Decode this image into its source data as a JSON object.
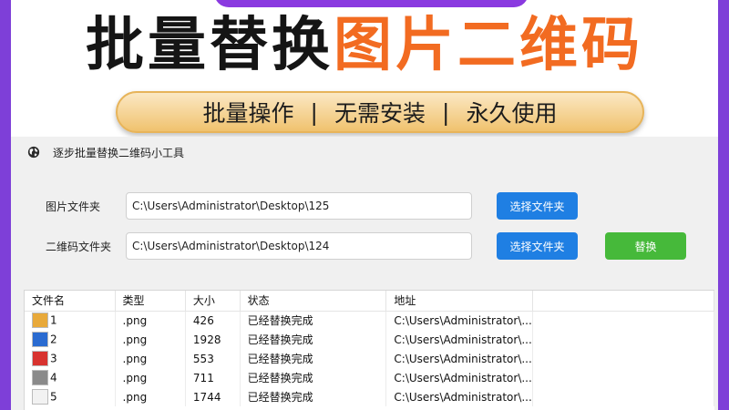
{
  "banner": {
    "headline_black": "批量替换",
    "headline_orange": "图片二维码",
    "features": [
      "批量操作",
      "无需安装",
      "永久使用"
    ],
    "separator": "|"
  },
  "window": {
    "title": "逐步批量替换二维码小工具"
  },
  "form": {
    "image_folder_label": "图片文件夹",
    "image_folder_value": "C:\\Users\\Administrator\\Desktop\\125",
    "qr_folder_label": "二维码文件夹",
    "qr_folder_value": "C:\\Users\\Administrator\\Desktop\\124",
    "choose_folder_label": "选择文件夹",
    "replace_label": "替换"
  },
  "table": {
    "columns": [
      "文件名",
      "类型",
      "大小",
      "状态",
      "地址"
    ],
    "rows": [
      {
        "name": "1",
        "type": ".png",
        "size": "426",
        "status": "已经替换完成",
        "address": "C:\\Users\\Administrator\\..."
      },
      {
        "name": "2",
        "type": ".png",
        "size": "1928",
        "status": "已经替换完成",
        "address": "C:\\Users\\Administrator\\..."
      },
      {
        "name": "3",
        "type": ".png",
        "size": "553",
        "status": "已经替换完成",
        "address": "C:\\Users\\Administrator\\..."
      },
      {
        "name": "4",
        "type": ".png",
        "size": "711",
        "status": "已经替换完成",
        "address": "C:\\Users\\Administrator\\..."
      },
      {
        "name": "5",
        "type": ".png",
        "size": "1744",
        "status": "已经替换完成",
        "address": "C:\\Users\\Administrator\\..."
      }
    ]
  },
  "colors": {
    "frame": "#7e3fd8",
    "headline_orange": "#f26b21",
    "button_blue": "#1f7fe3",
    "button_green": "#46b93a",
    "thumbnails": [
      "#e8a93a",
      "#2a6bd1",
      "#d8332f",
      "#8a8a8a",
      "#f2f2f2"
    ]
  },
  "icons": {
    "window": "globe-icon"
  }
}
